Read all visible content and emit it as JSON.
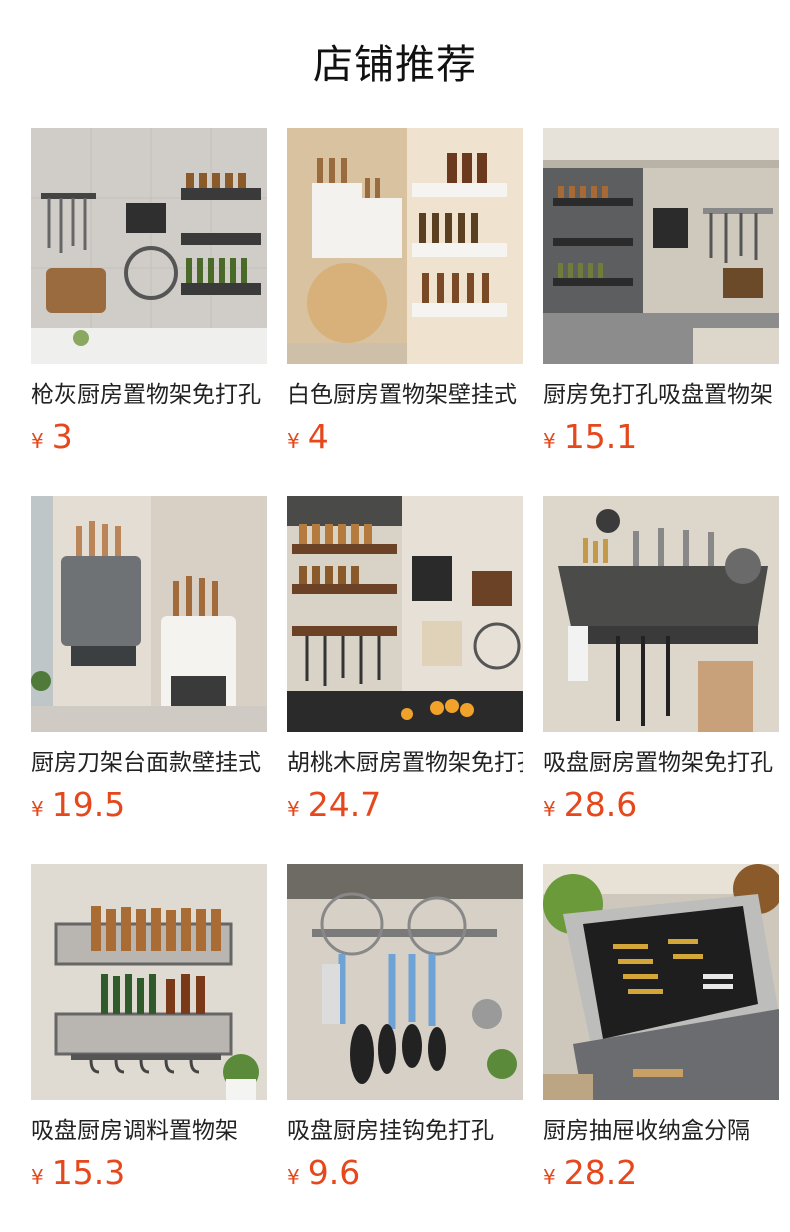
{
  "header": {
    "title": "店铺推荐"
  },
  "products": [
    {
      "name": "枪灰厨房置物架免打孔",
      "currency": "¥",
      "price": "3",
      "image": "gray-wall-shelf-photo"
    },
    {
      "name": "白色厨房置物架壁挂式",
      "currency": "¥",
      "price": "4",
      "image": "white-corner-shelf-photo"
    },
    {
      "name": "厨房免打孔吸盘置物架",
      "currency": "¥",
      "price": "15.1",
      "image": "suction-rack-photo"
    },
    {
      "name": "厨房刀架台面款壁挂式",
      "currency": "¥",
      "price": "19.5",
      "image": "knife-holder-photo"
    },
    {
      "name": "胡桃木厨房置物架免打孔",
      "currency": "¥",
      "price": "24.7",
      "image": "walnut-shelf-photo"
    },
    {
      "name": "吸盘厨房置物架免打孔",
      "currency": "¥",
      "price": "28.6",
      "image": "suction-shelf-photo"
    },
    {
      "name": "吸盘厨房调料置物架",
      "currency": "¥",
      "price": "15.3",
      "image": "spice-rack-photo"
    },
    {
      "name": "吸盘厨房挂钩免打孔",
      "currency": "¥",
      "price": "9.6",
      "image": "hook-bar-photo"
    },
    {
      "name": "厨房抽屉收纳盒分隔",
      "currency": "¥",
      "price": "28.2",
      "image": "drawer-organizer-photo"
    }
  ]
}
